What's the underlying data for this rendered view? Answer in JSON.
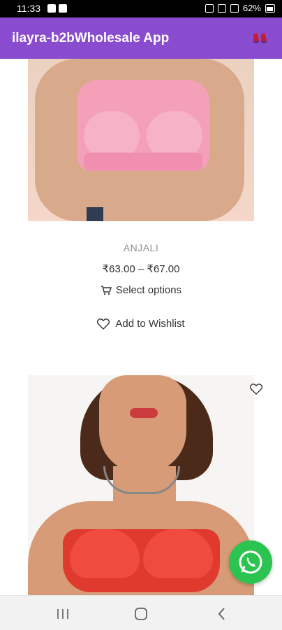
{
  "status_bar": {
    "time": "11:33",
    "battery": "62%"
  },
  "app_bar": {
    "title": "ilayra-b2bWholesale App",
    "logo_icon": "logo-icon"
  },
  "products": [
    {
      "title": "ANJALI",
      "price": "₹63.00 – ₹67.00",
      "select_label": "Select options",
      "wishlist_label": "Add to Wishlist"
    }
  ],
  "navigation": {
    "recents_icon": "recents-icon",
    "home_icon": "home-icon",
    "back_icon": "back-icon"
  },
  "colors": {
    "app_bar": "#8a4ccf",
    "whatsapp": "#2cc450"
  }
}
